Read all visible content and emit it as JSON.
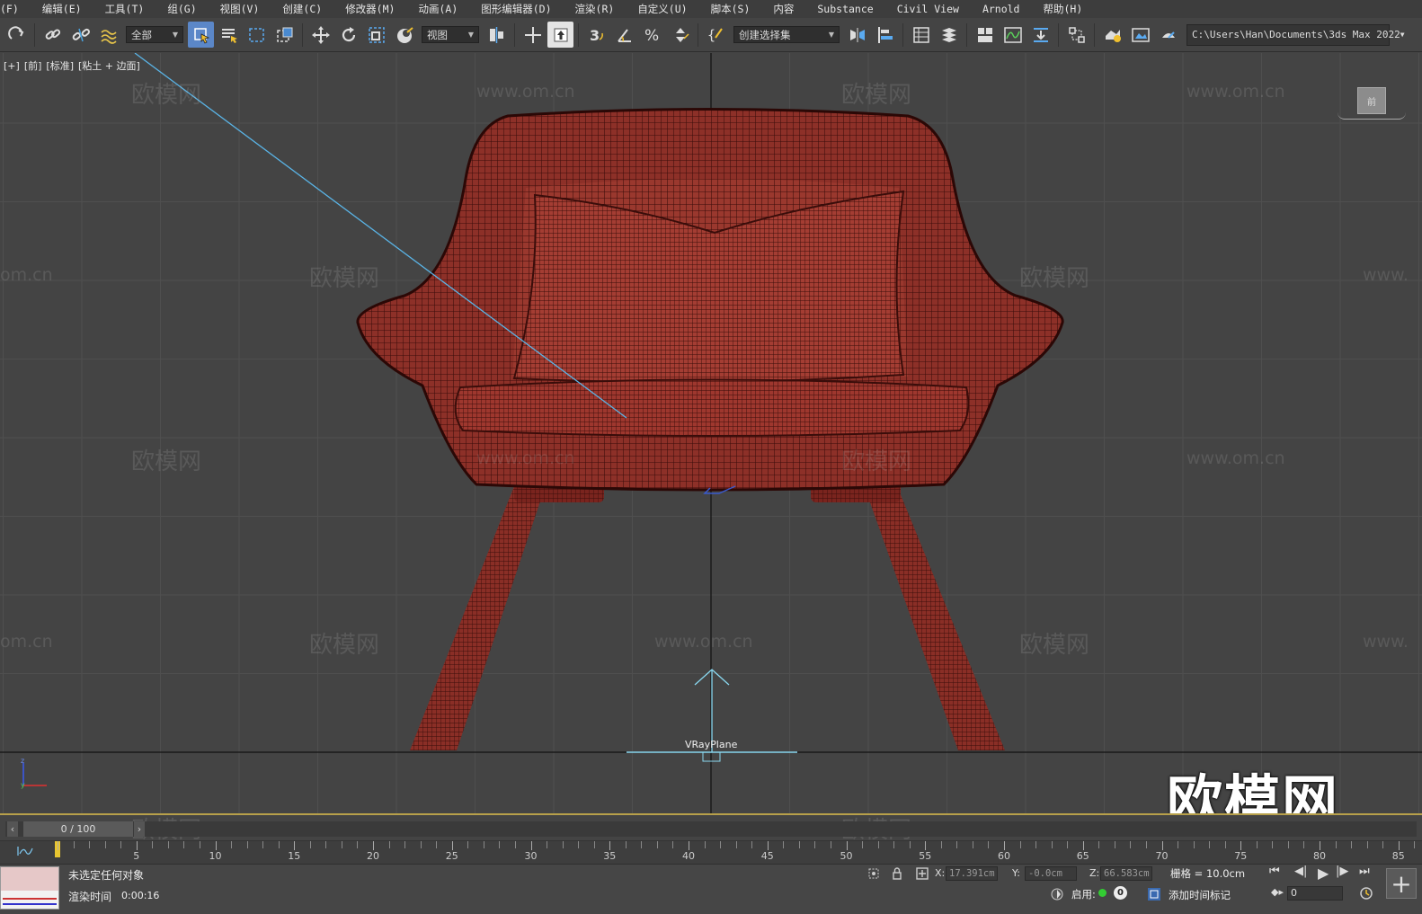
{
  "menu": [
    "(F)",
    "编辑(E)",
    "工具(T)",
    "组(G)",
    "视图(V)",
    "创建(C)",
    "修改器(M)",
    "动画(A)",
    "图形编辑器(D)",
    "渲染(R)",
    "自定义(U)",
    "脚本(S)",
    "内容",
    "Substance",
    "Civil View",
    "Arnold",
    "帮助(H)"
  ],
  "toolbar": {
    "filter_value": "全部",
    "coord_value": "视图",
    "selection_set": "创建选择集",
    "project_path": "C:\\Users\\Han\\Documents\\3ds Max 2022"
  },
  "viewport": {
    "label_parts": [
      "[+]",
      "[前]",
      "[标准]",
      "[粘土 + 边面]"
    ],
    "object_label": "VRayPlane",
    "viewcube_label": "前",
    "watermark_cn": "欧模网",
    "watermark_url": "www.om.cn",
    "watermark_url_partial": "om.cn",
    "watermark_url_partial2": "www.",
    "big_logo": "欧模网",
    "colors": {
      "background": "#444444",
      "model_fill": "#8a2e26",
      "wire": "#3a0d0a",
      "grid": "#4f4f4f"
    }
  },
  "timeline": {
    "frame_display": "0 / 100",
    "ruler_labels": [
      "5",
      "10",
      "15",
      "20",
      "25",
      "30",
      "35",
      "40",
      "45",
      "50",
      "55",
      "60",
      "65",
      "70",
      "75",
      "80",
      "85"
    ]
  },
  "status": {
    "selection": "未选定任何对象",
    "render_time_label": "渲染时间",
    "render_time": "0:00:16",
    "x_label": "X:",
    "x_value": "17.391cm",
    "y_label": "Y:",
    "y_value": "-0.0cm",
    "z_label": "Z:",
    "z_value": "66.583cm",
    "grid": "栅格 = 10.0cm",
    "enable_label": "启用:",
    "enable_count": "0",
    "add_time_tag": "添加时间标记",
    "current_frame": "0"
  }
}
